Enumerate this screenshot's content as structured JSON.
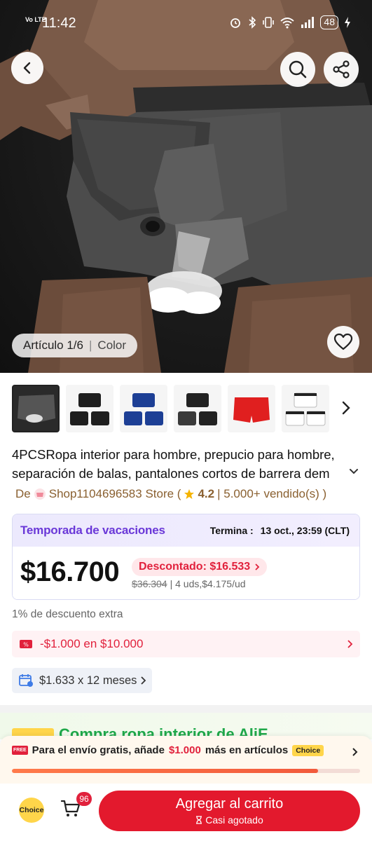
{
  "status_bar": {
    "network": "Vo LTE",
    "time": "11:42",
    "battery": "48"
  },
  "gallery": {
    "article_label": "Artículo 1/6",
    "color_label": "Color",
    "thumbnails": [
      {
        "name": "thumb-gray",
        "tone": "#3a3a3a"
      },
      {
        "name": "thumb-black",
        "tone": "#1e1e1e"
      },
      {
        "name": "thumb-navy",
        "tone": "#1d3f95"
      },
      {
        "name": "thumb-black-gray",
        "tone": "#2b2b2b"
      },
      {
        "name": "thumb-red",
        "tone": "#e01f1f"
      },
      {
        "name": "thumb-white",
        "tone": "#f2f2f2"
      }
    ]
  },
  "product": {
    "title": "4PCSRopa interior para hombre, prepucio para hombre, separación de balas, pantalones cortos de barrera dem",
    "seller_prefix": "De",
    "store_name": "Shop1104696583 Store (",
    "rating": "4.2",
    "sold": "| 5.000+ vendido(s) )"
  },
  "promo": {
    "season": "Temporada de vacaciones",
    "ends_label": "Termina :",
    "ends_value": "13 oct., 23:59 (CLT)",
    "price": "$16.700",
    "discount": "Descontado: $16.533",
    "old_price": "$36.304",
    "unit_info": "| 4 uds,$4.175/ud"
  },
  "extra_discount": "1% de descuento extra",
  "coupon": "-$1.000 en $10.000",
  "installments": "$1.633 x 12 meses",
  "choice_strip": {
    "text": "Compra ropa interior de AliE..."
  },
  "shipping": {
    "free_label": "FREE",
    "text_before": "Para el envío gratis, añade",
    "amount": "$1.000",
    "text_after": "más en artículos",
    "choice_label": "Choice",
    "progress_fraction": 0.88
  },
  "bottom_bar": {
    "choice_label": "Choice",
    "cart_count": "96",
    "add_to_cart": "Agregar al carrito",
    "stock_note": "Casi agotado"
  },
  "colors": {
    "accent_red": "#e3192d",
    "season_purple": "#6a38d8",
    "seller_brown": "#8a6030",
    "choice_yellow": "#ffd54a"
  }
}
